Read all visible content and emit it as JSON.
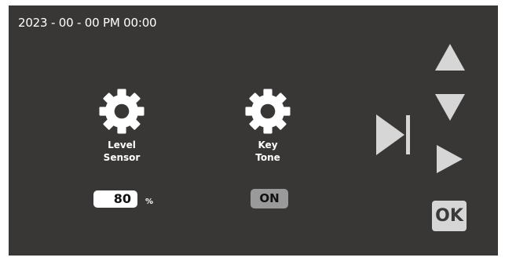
{
  "status": {
    "datetime": "2023 - 00 - 00 PM 00:00"
  },
  "settings": [
    {
      "icon": "gear-icon",
      "label": "Level\nSensor",
      "value": "80",
      "unit": "%"
    },
    {
      "icon": "gear-icon",
      "label": "Key\nTone",
      "value": "ON"
    }
  ],
  "controls": {
    "up_icon": "triangle-up-icon",
    "down_icon": "triangle-down-icon",
    "right_icon": "triangle-right-icon",
    "skip_icon": "skip-next-icon",
    "ok_label": "OK"
  },
  "colors": {
    "screen_bg": "#393735",
    "text": "#ffffff",
    "button": "#d6d6d6",
    "toggle": "#9a9a9a"
  }
}
